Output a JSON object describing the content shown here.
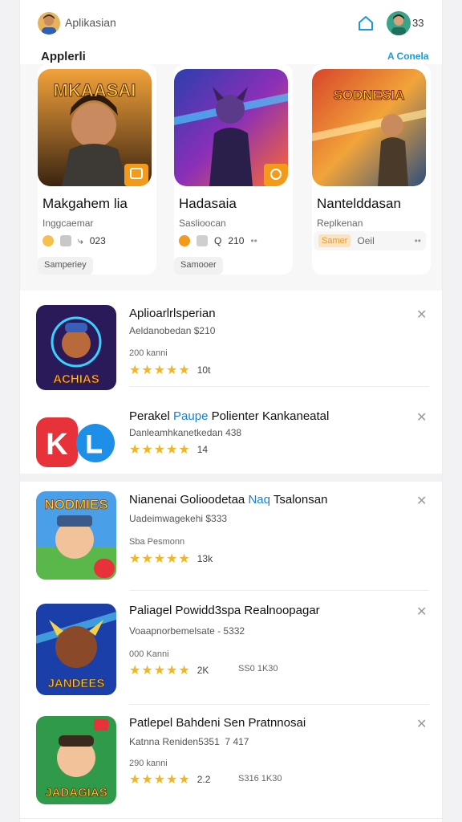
{
  "header": {
    "app_name": "Aplikasian",
    "top_count": "33"
  },
  "section": {
    "title": "Applerli",
    "see_all": "A Conela"
  },
  "featured": [
    {
      "art_text": "MKAASAI",
      "title": "Makgahem lia",
      "subtitle": "Inggcaemar",
      "stat": "023",
      "chip": "Samperiey"
    },
    {
      "art_text": "",
      "title": "Hadasaia",
      "subtitle": "Saslioocan",
      "stat": "210",
      "chip": "Samooer"
    },
    {
      "art_text": "SODNESIA",
      "title": "Nantelddasan",
      "subtitle": "Replkenan",
      "stat": "Oeil",
      "chip": "Samer"
    }
  ],
  "list": [
    {
      "title": "Aplioarlrlsperian",
      "title_hl": "",
      "title_tail": "",
      "subtitle": "Aeldanobedan $210",
      "meta": "200 kanni",
      "stars": "★★★★★",
      "rating": "10t",
      "extra": "",
      "art_text": "ACHIAS"
    },
    {
      "title": "Perakel ",
      "title_hl": "Paupe",
      "title_tail": " Polienter Kankaneatal",
      "subtitle": "Danleamhkanetkedan 438",
      "meta": "",
      "stars": "★★★★★",
      "rating": "14",
      "extra": "",
      "art_text": ""
    },
    {
      "title": "Nianenai Golioodetaa ",
      "title_hl": "Naq",
      "title_tail": " Tsalonsan",
      "subtitle": "Uadeimwagekehi $333",
      "meta": "Sba Pesmonn",
      "stars": "★★★★★",
      "rating": "13k",
      "extra": "",
      "art_text": "NODMIES"
    },
    {
      "title": "Paliagel Powidd3spa Realnoopagar",
      "title_hl": "",
      "title_tail": "",
      "subtitle": "Voaapnorbemelsate - 5332",
      "meta": "000 Kanni",
      "stars": "★★★★★",
      "rating": "2K",
      "extra": "SS0 1K30",
      "art_text": "JANDEES"
    },
    {
      "title": "Patlepel Bahdeni Sen Pratnnosai",
      "title_hl": "",
      "title_tail": "",
      "subtitle": "Katnna Reniden5351  7 417",
      "meta": "290 kanni",
      "stars": "★★★★★",
      "rating": "2.2",
      "extra": "S316 1K30",
      "art_text": "JADAGIAS"
    }
  ],
  "colors": {
    "accent": "#1a9bd7",
    "star": "#f3b623",
    "orange": "#f39a1b"
  }
}
